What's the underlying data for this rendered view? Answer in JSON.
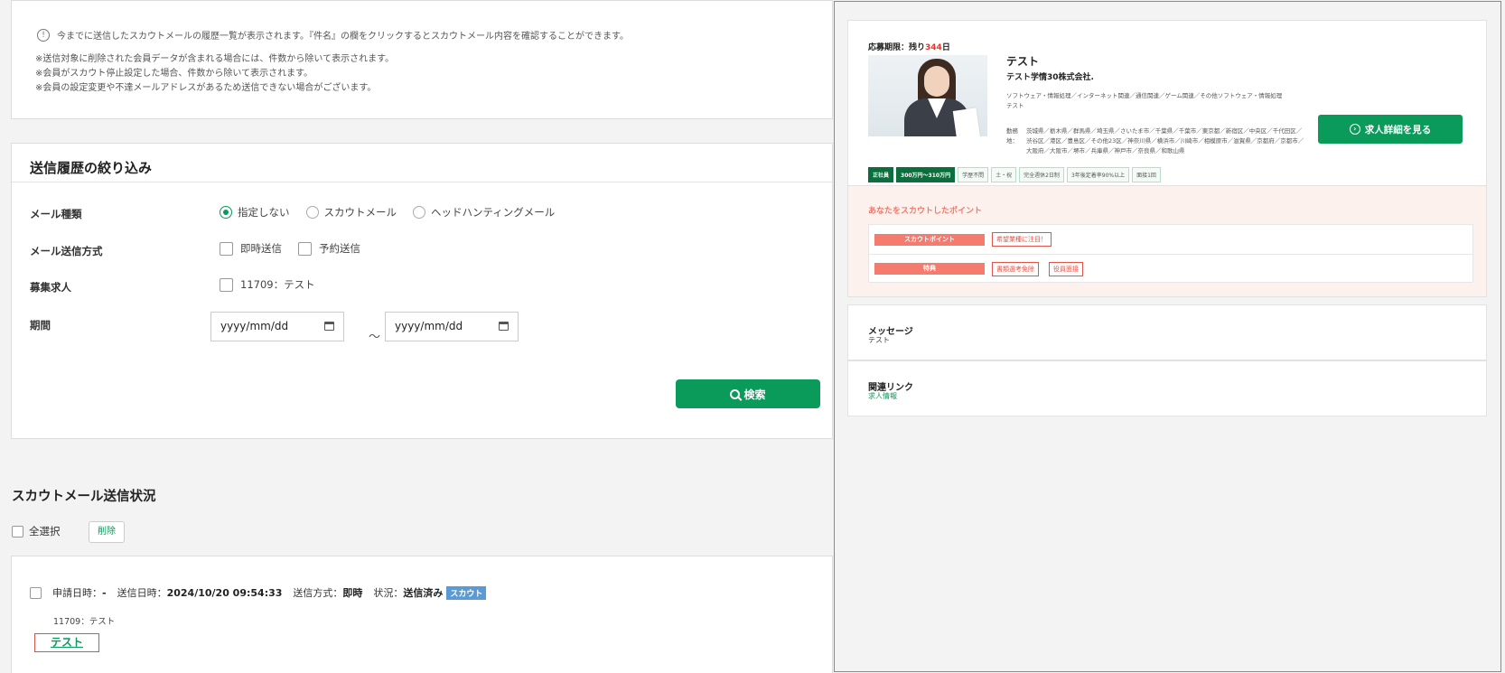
{
  "notice": {
    "main": "今までに送信したスカウトメールの履歴一覧が表示されます。『件名』の欄をクリックするとスカウトメール内容を確認することができます。",
    "notes": [
      "※送信対象に削除された会員データが含まれる場合には、件数から除いて表示されます。",
      "※会員がスカウト停止設定した場合、件数から除いて表示されます。",
      "※会員の設定変更や不達メールアドレスがあるため送信できない場合がございます。"
    ]
  },
  "filter": {
    "title": "送信履歴の絞り込み",
    "mail_type": {
      "label": "メール種類",
      "options": [
        "指定しない",
        "スカウトメール",
        "ヘッドハンティングメール"
      ],
      "selected": "指定しない"
    },
    "send_method": {
      "label": "メール送信方式",
      "options": [
        "即時送信",
        "予約送信"
      ]
    },
    "job": {
      "label": "募集求人",
      "options": [
        "11709：テスト"
      ]
    },
    "period": {
      "label": "期間",
      "from_placeholder": "yyyy/mm/dd",
      "to_placeholder": "yyyy/mm/dd",
      "separator": "～"
    },
    "search_label": "検索"
  },
  "status": {
    "title": "スカウトメール送信状況",
    "select_all": "全選択",
    "delete_label": "削除",
    "item": {
      "applied_label": "申請日時：",
      "applied_value": "-",
      "sent_label": "送信日時：",
      "sent_value": "2024/10/20 09:54:33",
      "method_label": "送信方式：",
      "method_value": "即時",
      "state_label": "状況：",
      "state_value": "送信済み",
      "badge": "スカウト",
      "job": "11709：テスト",
      "subject": "テスト"
    }
  },
  "preview": {
    "deadline_prefix": "応募期限：残り",
    "deadline_days": "344",
    "deadline_suffix": "日",
    "job_title": "テスト",
    "company": "テスト学情30株式会社.",
    "industries": "ソフトウェア・情報処理／インターネット関連／通信関連／ゲーム関連／その他ソフトウェア・情報処理",
    "description": "テスト",
    "location_label": "勤務地：",
    "location": "茨城県／栃木県／群馬県／埼玉県／さいたま市／千葉県／千葉市／東京都／新宿区／中央区／千代田区／渋谷区／港区／豊島区／その他23区／神奈川県／横浜市／川崎市／相模原市／滋賀県／京都府／京都市／大阪府／大阪市／堺市／兵庫県／神戸市／奈良県／和歌山県",
    "detail_button": "求人詳細を見る",
    "tags": [
      "正社員",
      "300万円〜310万円",
      "学歴不問",
      "土・祝",
      "完全週休2日制",
      "3年後定着率90%以上",
      "面接1回"
    ],
    "points_title": "あなたをスカウトしたポイント",
    "points": [
      {
        "label": "スカウトポイント",
        "values": [
          "希望業種に注目！"
        ]
      },
      {
        "label": "特典",
        "values": [
          "書類選考免除",
          "役員面接"
        ]
      }
    ],
    "message_title": "メッセージ",
    "message_body": "テスト",
    "link_title": "関連リンク",
    "link_body": "求人情報"
  },
  "colors": {
    "accent": "#0a9a5a",
    "deadline": "#e0352b",
    "points": "#f47b6d",
    "badge": "#5a9bd6"
  }
}
